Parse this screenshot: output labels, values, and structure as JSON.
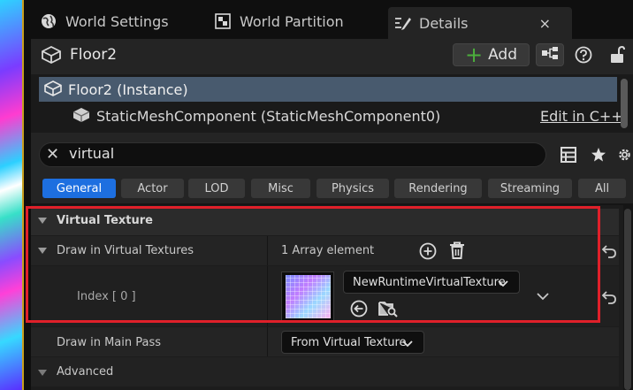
{
  "tabs": [
    {
      "label": "World Settings",
      "icon": "globe-icon"
    },
    {
      "label": "World Partition",
      "icon": "grid-map-icon"
    },
    {
      "label": "Details",
      "icon": "details-pencil-icon",
      "active": true
    }
  ],
  "close_label": "×",
  "header": {
    "actor_name": "Floor2",
    "add_label": "Add"
  },
  "tree": {
    "root_label": "Floor2 (Instance)",
    "child_label": "StaticMeshComponent (StaticMeshComponent0)",
    "edit_link": "Edit in C++"
  },
  "search": {
    "value": "virtual",
    "clear": "✕"
  },
  "filters": [
    "General",
    "Actor",
    "LOD",
    "Misc",
    "Physics",
    "Rendering",
    "Streaming",
    "All"
  ],
  "active_filter": "General",
  "properties": {
    "category_virtual_texture": "Virtual Texture",
    "draw_in_vt_label": "Draw in Virtual Textures",
    "draw_in_vt_value": "1 Array element",
    "index_label": "Index [ 0 ]",
    "vt_asset_name": "NewRuntimeVirtualTexture",
    "draw_in_main_pass_label": "Draw in Main Pass",
    "draw_in_main_pass_value": "From Virtual Texture",
    "category_advanced": "Advanced"
  },
  "colors": {
    "accent_blue": "#1d6fe0",
    "selection": "#485a6e",
    "highlight_box": "#e0202a",
    "add_plus": "#4caf3c"
  }
}
